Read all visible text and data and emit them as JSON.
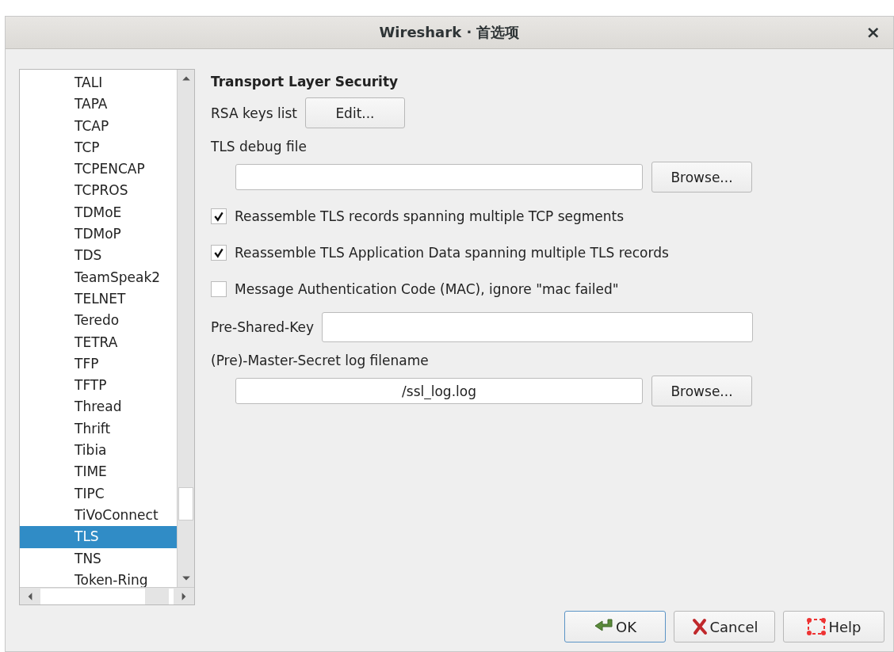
{
  "window": {
    "title": "Wireshark · 首选项",
    "close": "×"
  },
  "protocols": [
    {
      "label": "TALI",
      "selected": false
    },
    {
      "label": "TAPA",
      "selected": false
    },
    {
      "label": "TCAP",
      "selected": false
    },
    {
      "label": "TCP",
      "selected": false
    },
    {
      "label": "TCPENCAP",
      "selected": false
    },
    {
      "label": "TCPROS",
      "selected": false
    },
    {
      "label": "TDMoE",
      "selected": false
    },
    {
      "label": "TDMoP",
      "selected": false
    },
    {
      "label": "TDS",
      "selected": false
    },
    {
      "label": "TeamSpeak2",
      "selected": false
    },
    {
      "label": "TELNET",
      "selected": false
    },
    {
      "label": "Teredo",
      "selected": false
    },
    {
      "label": "TETRA",
      "selected": false
    },
    {
      "label": "TFP",
      "selected": false
    },
    {
      "label": "TFTP",
      "selected": false
    },
    {
      "label": "Thread",
      "selected": false
    },
    {
      "label": "Thrift",
      "selected": false
    },
    {
      "label": "Tibia",
      "selected": false
    },
    {
      "label": "TIME",
      "selected": false
    },
    {
      "label": "TIPC",
      "selected": false
    },
    {
      "label": "TiVoConnect",
      "selected": false
    },
    {
      "label": "TLS",
      "selected": true
    },
    {
      "label": "TNS",
      "selected": false
    },
    {
      "label": "Token-Ring",
      "selected": false
    }
  ],
  "section_title": "Transport Layer Security",
  "rsa_keys": {
    "label": "RSA keys list",
    "button": "Edit..."
  },
  "debug_file": {
    "label": "TLS debug file",
    "button": "Browse..."
  },
  "options": [
    {
      "label": "Reassemble TLS records spanning multiple TCP segments",
      "checked": true
    },
    {
      "label": "Reassemble TLS Application Data spanning multiple TLS records",
      "checked": true
    },
    {
      "label": "Message Authentication Code (MAC), ignore \"mac failed\"",
      "checked": false
    }
  ],
  "psk": {
    "label": "Pre-Shared-Key"
  },
  "keylog": {
    "label": "(Pre)-Master-Secret log filename",
    "value": "/ssl_log.log",
    "button": "Browse..."
  },
  "buttons": [
    {
      "kind": "ok",
      "label": "OK"
    },
    {
      "kind": "cancel",
      "label": "Cancel"
    },
    {
      "kind": "help",
      "label": "Help"
    }
  ]
}
